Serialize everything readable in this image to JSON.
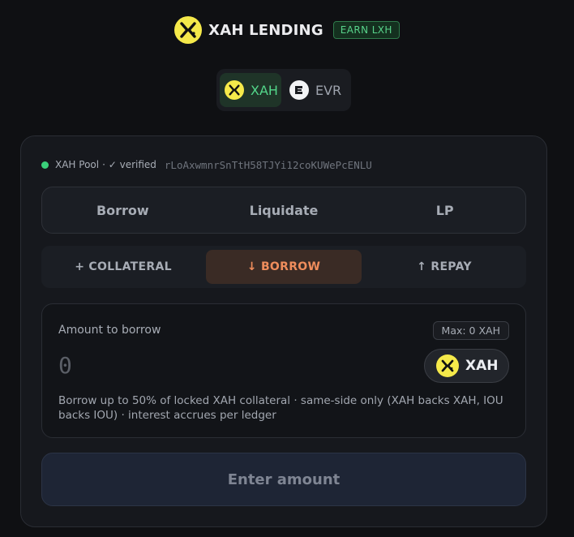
{
  "header": {
    "title": "XAH LENDING",
    "badge": "EARN LXH",
    "logo_icon": "xahau-x-icon",
    "accent": "#f5e94a"
  },
  "network_switch": {
    "items": [
      {
        "label": "XAH",
        "icon": "xahau-x-icon",
        "active": true
      },
      {
        "label": "EVR",
        "icon": "evernode-icon",
        "active": false
      }
    ]
  },
  "pool": {
    "name": "XAH Pool",
    "verified": "· ✓ verified",
    "address": "rLoAxwmnrSnTtH58TJYi12coKUWePcENLU",
    "status_color": "#3ad07a"
  },
  "tabs": [
    "Borrow",
    "Liquidate",
    "LP"
  ],
  "subtabs": {
    "collateral": "+ COLLATERAL",
    "borrow": "↓ BORROW",
    "repay": "↑ REPAY"
  },
  "form": {
    "label": "Amount to borrow",
    "max": "Max: 0 XAH",
    "placeholder": "0",
    "token": "XAH",
    "hint": "Borrow up to 50% of locked XAH collateral · same-side only (XAH backs XAH, IOU backs IOU) · interest accrues per ledger"
  },
  "cta": "Enter amount"
}
